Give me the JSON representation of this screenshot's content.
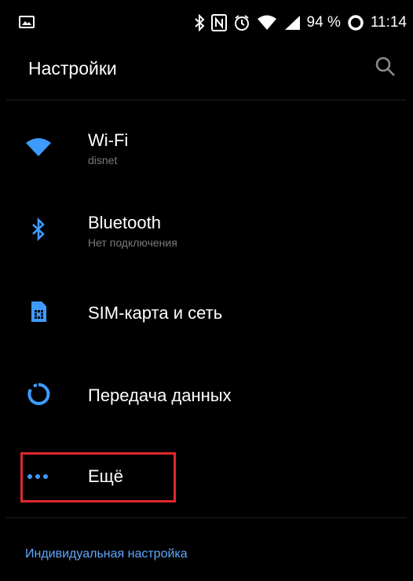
{
  "status_bar": {
    "battery": "94 %",
    "time": "11:14"
  },
  "header": {
    "title": "Настройки"
  },
  "items": [
    {
      "label": "Wi-Fi",
      "sub": "disnet",
      "icon": "wifi-icon"
    },
    {
      "label": "Bluetooth",
      "sub": "Нет подключения",
      "icon": "bluetooth-icon"
    },
    {
      "label": "SIM-карта и сеть",
      "sub": "",
      "icon": "sim-card-icon"
    },
    {
      "label": "Передача данных",
      "sub": "",
      "icon": "data-usage-icon"
    },
    {
      "label": "Ещё",
      "sub": "",
      "icon": "more-dots-icon"
    }
  ],
  "footer": {
    "link": "Индивидуальная настройка"
  },
  "colors": {
    "accent": "#3d9bff",
    "highlight": "#e0282e",
    "link": "#5ea8ff"
  }
}
